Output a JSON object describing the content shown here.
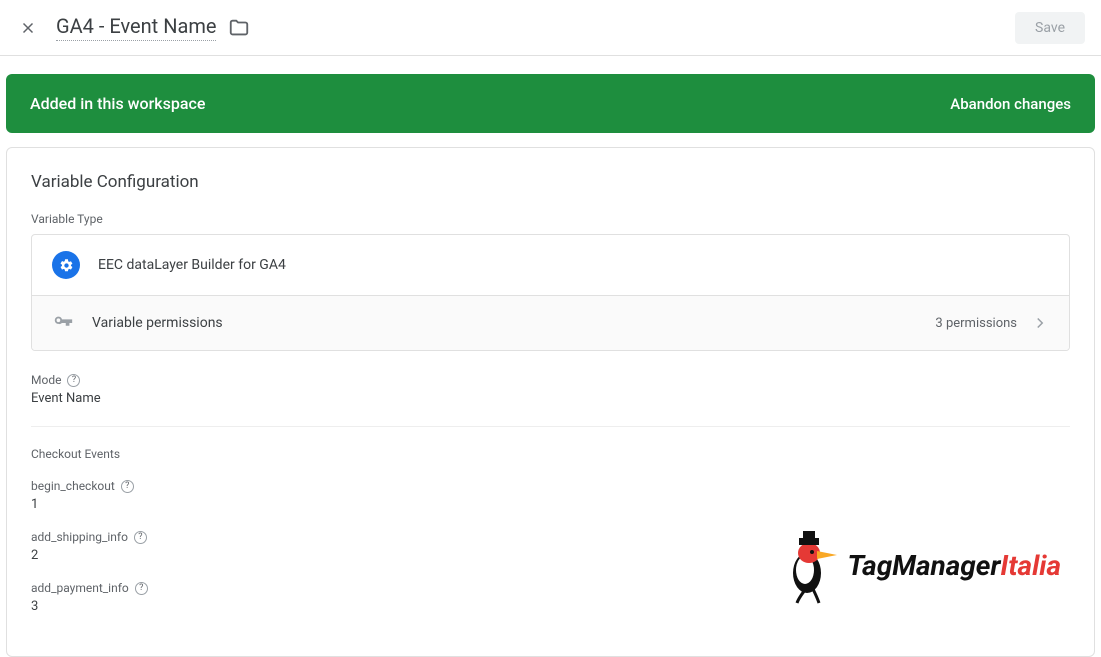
{
  "header": {
    "title": "GA4 - Event Name",
    "save_label": "Save"
  },
  "banner": {
    "message": "Added in this workspace",
    "action": "Abandon changes"
  },
  "config": {
    "section_title": "Variable Configuration",
    "type_label": "Variable Type",
    "type_name": "EEC dataLayer Builder for GA4",
    "permissions_label": "Variable permissions",
    "permissions_count": "3 permissions",
    "mode": {
      "label": "Mode",
      "value": "Event Name"
    },
    "checkout_label": "Checkout Events",
    "events": [
      {
        "label": "begin_checkout",
        "value": "1"
      },
      {
        "label": "add_shipping_info",
        "value": "2"
      },
      {
        "label": "add_payment_info",
        "value": "3"
      }
    ]
  },
  "watermark": {
    "text1": "TagManager",
    "text2": "Italia"
  }
}
